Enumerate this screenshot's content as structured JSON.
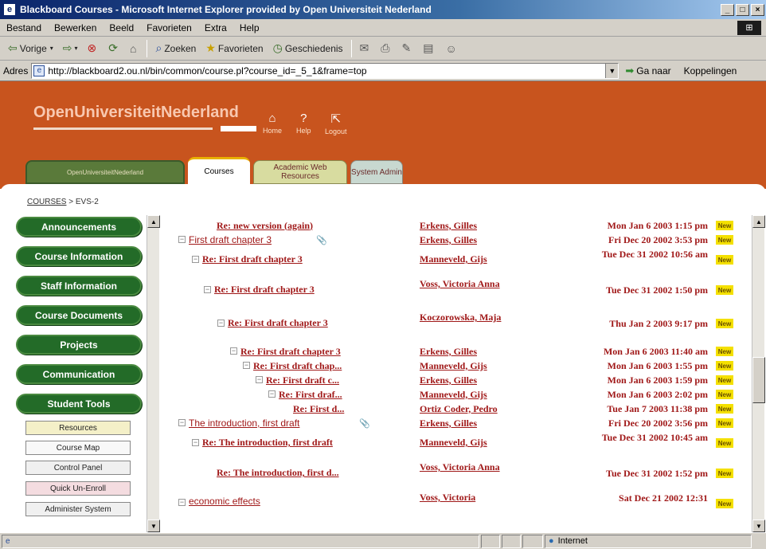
{
  "window": {
    "title": "Blackboard Courses - Microsoft Internet Explorer provided by Open Universiteit Nederland",
    "minimize": "_",
    "restore": "□",
    "close": "×"
  },
  "menu": [
    "Bestand",
    "Bewerken",
    "Beeld",
    "Favorieten",
    "Extra",
    "Help"
  ],
  "toolbar": {
    "back": "Vorige",
    "forward": "",
    "stop": "",
    "refresh": "",
    "home": "",
    "search": "Zoeken",
    "favorites": "Favorieten",
    "history": "Geschiedenis"
  },
  "address": {
    "label": "Adres",
    "url": "http://blackboard2.ou.nl/bin/common/course.pl?course_id=_5_1&frame=top",
    "go": "Ga naar",
    "links": "Koppelingen"
  },
  "header": {
    "logo": "OpenUniversiteitNederland",
    "nav": [
      {
        "label": "Home",
        "icon": "home-icon"
      },
      {
        "label": "Help",
        "icon": "help-icon"
      },
      {
        "label": "Logout",
        "icon": "logout-icon"
      }
    ]
  },
  "tabs": {
    "home": "OpenUniversiteitNederland",
    "courses": "Courses",
    "web_resources": "Academic Web Resources",
    "admin": "System Admin"
  },
  "breadcrumb": {
    "courses": "COURSES",
    "separator": ">",
    "current": "EVS-2"
  },
  "leftnav": {
    "green": [
      "Announcements",
      "Course Information",
      "Staff Information",
      "Course Documents",
      "Projects",
      "Communication",
      "Student Tools"
    ],
    "small": [
      "Resources",
      "Course Map",
      "Control Panel",
      "Quick Un-Enroll",
      "Administer System"
    ]
  },
  "thread": [
    {
      "subject": "Re: new version (again)",
      "author": "Erkens, Gilles",
      "date": "Mon Jan 6 2003 1:15 pm",
      "new": "New"
    },
    {
      "subject": "First draft chapter 3",
      "author": "Erkens, Gilles",
      "date": "Fri Dec 20 2002 3:53 pm",
      "new": "New"
    },
    {
      "subject": "Re: First draft chapter 3",
      "author": "Manneveld, Gijs",
      "date": "Tue Dec 31 2002 10:56 am",
      "new": "New"
    },
    {
      "subject": "Re: First draft chapter 3",
      "author": "Voss, Victoria Anna",
      "date": "Tue Dec 31 2002 1:50 pm",
      "new": "New"
    },
    {
      "subject": "Re: First draft chapter 3",
      "author": "Koczorowska, Maja",
      "date": "Thu Jan 2 2003 9:17 pm",
      "new": "New"
    },
    {
      "subject": "Re: First draft chapter 3",
      "author": "Erkens, Gilles",
      "date": "Mon Jan 6 2003 11:40 am",
      "new": "New"
    },
    {
      "subject": "Re: First draft chap...",
      "author": "Manneveld, Gijs",
      "date": "Mon Jan 6 2003 1:55 pm",
      "new": "New"
    },
    {
      "subject": "Re: First draft c...",
      "author": "Erkens, Gilles",
      "date": "Mon Jan 6 2003 1:59 pm",
      "new": "New"
    },
    {
      "subject": "Re: First draf...",
      "author": "Manneveld, Gijs",
      "date": "Mon Jan 6 2003 2:02 pm",
      "new": "New"
    },
    {
      "subject": "Re: First d...",
      "author": "Ortiz Coder, Pedro",
      "date": "Tue Jan 7 2003 11:38 pm",
      "new": "New"
    },
    {
      "subject": "The introduction, first draft",
      "author": "Erkens, Gilles",
      "date": "Fri Dec 20 2002 3:56 pm",
      "new": "New"
    },
    {
      "subject": "Re: The introduction, first draft",
      "author": "Manneveld, Gijs",
      "date": "Tue Dec 31 2002 10:45 am",
      "new": "New"
    },
    {
      "subject": "Re: The introduction, first d...",
      "author": "Voss, Victoria Anna",
      "date": "Tue Dec 31 2002 1:52 pm",
      "new": "New"
    },
    {
      "subject": "economic effects",
      "author": "Voss, Victoria",
      "date": "Sat Dec 21 2002 12:31",
      "new": "New"
    }
  ],
  "status": {
    "zone": "Internet"
  }
}
